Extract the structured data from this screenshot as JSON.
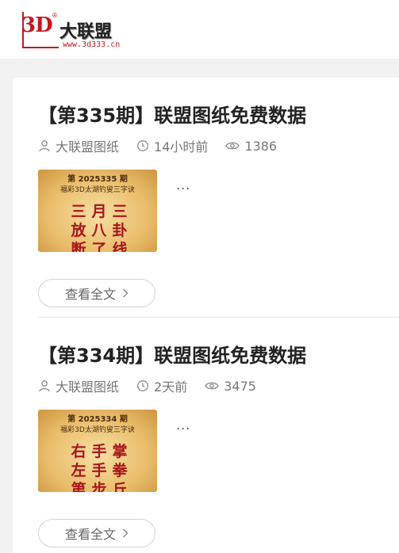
{
  "header": {
    "logo_mark": "3D",
    "logo_registered": "®",
    "logo_name": "大联盟",
    "logo_url": "www.3d333.cn"
  },
  "posts": [
    {
      "title": "【第335期】联盟图纸免费数据",
      "author": "大联盟图纸",
      "time": "14小时前",
      "views": "1386",
      "excerpt": "...",
      "read_more": "查看全文",
      "thumbnail": {
        "issue": "第 2025335 期",
        "subtitle": "福彩3D太湖钓叟三字诀",
        "chars": [
          "三",
          "月",
          "三",
          "放",
          "八",
          "卦",
          "断",
          "了",
          "线"
        ]
      }
    },
    {
      "title": "【第334期】联盟图纸免费数据",
      "author": "大联盟图纸",
      "time": "2天前",
      "views": "3475",
      "excerpt": "...",
      "read_more": "查看全文",
      "thumbnail": {
        "issue": "第 2025334 期",
        "subtitle": "福彩3D太湖钓叟三字诀",
        "chars": [
          "右",
          "手",
          "掌",
          "左",
          "手",
          "拳",
          "第",
          "步",
          "丘"
        ]
      }
    }
  ],
  "icons": {
    "author": "user-icon",
    "time": "clock-icon",
    "views": "eye-icon",
    "read_more": "chevron-right-icon"
  },
  "colors": {
    "brand_red": "#c8161d",
    "title": "#222222",
    "meta": "#777777",
    "background": "#f2f2f2"
  }
}
